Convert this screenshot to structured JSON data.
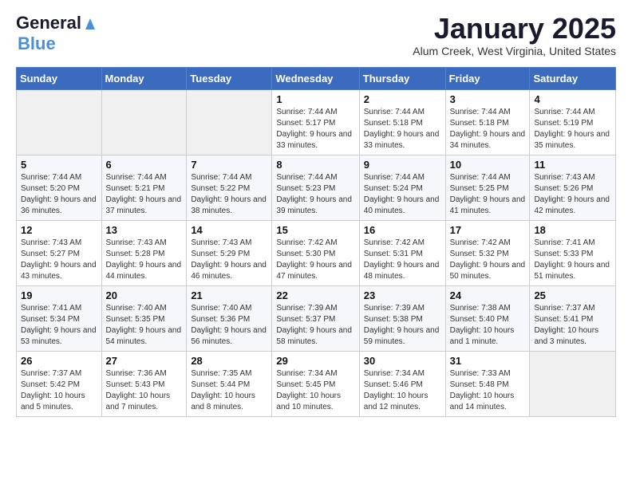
{
  "header": {
    "logo_general": "General",
    "logo_blue": "Blue",
    "month_title": "January 2025",
    "subtitle": "Alum Creek, West Virginia, United States"
  },
  "days_of_week": [
    "Sunday",
    "Monday",
    "Tuesday",
    "Wednesday",
    "Thursday",
    "Friday",
    "Saturday"
  ],
  "weeks": [
    [
      {
        "day": "",
        "info": ""
      },
      {
        "day": "",
        "info": ""
      },
      {
        "day": "",
        "info": ""
      },
      {
        "day": "1",
        "info": "Sunrise: 7:44 AM\nSunset: 5:17 PM\nDaylight: 9 hours and 33 minutes."
      },
      {
        "day": "2",
        "info": "Sunrise: 7:44 AM\nSunset: 5:18 PM\nDaylight: 9 hours and 33 minutes."
      },
      {
        "day": "3",
        "info": "Sunrise: 7:44 AM\nSunset: 5:18 PM\nDaylight: 9 hours and 34 minutes."
      },
      {
        "day": "4",
        "info": "Sunrise: 7:44 AM\nSunset: 5:19 PM\nDaylight: 9 hours and 35 minutes."
      }
    ],
    [
      {
        "day": "5",
        "info": "Sunrise: 7:44 AM\nSunset: 5:20 PM\nDaylight: 9 hours and 36 minutes."
      },
      {
        "day": "6",
        "info": "Sunrise: 7:44 AM\nSunset: 5:21 PM\nDaylight: 9 hours and 37 minutes."
      },
      {
        "day": "7",
        "info": "Sunrise: 7:44 AM\nSunset: 5:22 PM\nDaylight: 9 hours and 38 minutes."
      },
      {
        "day": "8",
        "info": "Sunrise: 7:44 AM\nSunset: 5:23 PM\nDaylight: 9 hours and 39 minutes."
      },
      {
        "day": "9",
        "info": "Sunrise: 7:44 AM\nSunset: 5:24 PM\nDaylight: 9 hours and 40 minutes."
      },
      {
        "day": "10",
        "info": "Sunrise: 7:44 AM\nSunset: 5:25 PM\nDaylight: 9 hours and 41 minutes."
      },
      {
        "day": "11",
        "info": "Sunrise: 7:43 AM\nSunset: 5:26 PM\nDaylight: 9 hours and 42 minutes."
      }
    ],
    [
      {
        "day": "12",
        "info": "Sunrise: 7:43 AM\nSunset: 5:27 PM\nDaylight: 9 hours and 43 minutes."
      },
      {
        "day": "13",
        "info": "Sunrise: 7:43 AM\nSunset: 5:28 PM\nDaylight: 9 hours and 44 minutes."
      },
      {
        "day": "14",
        "info": "Sunrise: 7:43 AM\nSunset: 5:29 PM\nDaylight: 9 hours and 46 minutes."
      },
      {
        "day": "15",
        "info": "Sunrise: 7:42 AM\nSunset: 5:30 PM\nDaylight: 9 hours and 47 minutes."
      },
      {
        "day": "16",
        "info": "Sunrise: 7:42 AM\nSunset: 5:31 PM\nDaylight: 9 hours and 48 minutes."
      },
      {
        "day": "17",
        "info": "Sunrise: 7:42 AM\nSunset: 5:32 PM\nDaylight: 9 hours and 50 minutes."
      },
      {
        "day": "18",
        "info": "Sunrise: 7:41 AM\nSunset: 5:33 PM\nDaylight: 9 hours and 51 minutes."
      }
    ],
    [
      {
        "day": "19",
        "info": "Sunrise: 7:41 AM\nSunset: 5:34 PM\nDaylight: 9 hours and 53 minutes."
      },
      {
        "day": "20",
        "info": "Sunrise: 7:40 AM\nSunset: 5:35 PM\nDaylight: 9 hours and 54 minutes."
      },
      {
        "day": "21",
        "info": "Sunrise: 7:40 AM\nSunset: 5:36 PM\nDaylight: 9 hours and 56 minutes."
      },
      {
        "day": "22",
        "info": "Sunrise: 7:39 AM\nSunset: 5:37 PM\nDaylight: 9 hours and 58 minutes."
      },
      {
        "day": "23",
        "info": "Sunrise: 7:39 AM\nSunset: 5:38 PM\nDaylight: 9 hours and 59 minutes."
      },
      {
        "day": "24",
        "info": "Sunrise: 7:38 AM\nSunset: 5:40 PM\nDaylight: 10 hours and 1 minute."
      },
      {
        "day": "25",
        "info": "Sunrise: 7:37 AM\nSunset: 5:41 PM\nDaylight: 10 hours and 3 minutes."
      }
    ],
    [
      {
        "day": "26",
        "info": "Sunrise: 7:37 AM\nSunset: 5:42 PM\nDaylight: 10 hours and 5 minutes."
      },
      {
        "day": "27",
        "info": "Sunrise: 7:36 AM\nSunset: 5:43 PM\nDaylight: 10 hours and 7 minutes."
      },
      {
        "day": "28",
        "info": "Sunrise: 7:35 AM\nSunset: 5:44 PM\nDaylight: 10 hours and 8 minutes."
      },
      {
        "day": "29",
        "info": "Sunrise: 7:34 AM\nSunset: 5:45 PM\nDaylight: 10 hours and 10 minutes."
      },
      {
        "day": "30",
        "info": "Sunrise: 7:34 AM\nSunset: 5:46 PM\nDaylight: 10 hours and 12 minutes."
      },
      {
        "day": "31",
        "info": "Sunrise: 7:33 AM\nSunset: 5:48 PM\nDaylight: 10 hours and 14 minutes."
      },
      {
        "day": "",
        "info": ""
      }
    ]
  ]
}
